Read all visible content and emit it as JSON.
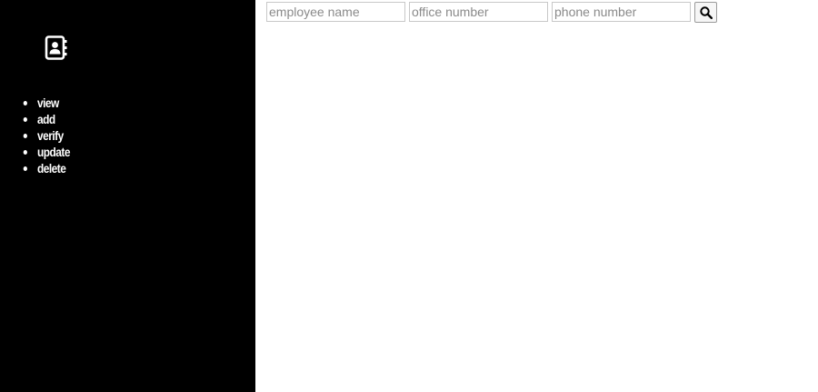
{
  "sidebar": {
    "logo_icon": "address-book-icon",
    "nav": [
      {
        "label": "view"
      },
      {
        "label": "add"
      },
      {
        "label": "verify"
      },
      {
        "label": "update"
      },
      {
        "label": "delete"
      }
    ]
  },
  "search": {
    "employee_name": {
      "value": "",
      "placeholder": "employee name"
    },
    "office_number": {
      "value": "",
      "placeholder": "office number"
    },
    "phone_number": {
      "value": "",
      "placeholder": "phone number"
    },
    "button_icon": "search-icon"
  },
  "colors": {
    "sidebar_bg": "#000000",
    "sidebar_text": "#ffffff",
    "main_bg": "#ffffff"
  }
}
